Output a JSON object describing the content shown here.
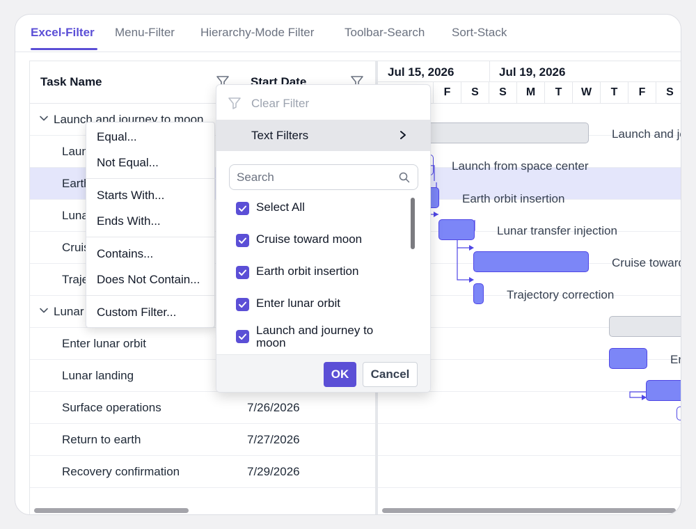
{
  "tabs": [
    {
      "label": "Excel-Filter"
    },
    {
      "label": "Menu-Filter"
    },
    {
      "label": "Hierarchy-Mode Filter"
    },
    {
      "label": "Toolbar-Search"
    },
    {
      "label": "Sort-Stack"
    }
  ],
  "grid": {
    "columns": {
      "task_name": "Task Name",
      "start_date": "Start Date"
    },
    "rows": [
      {
        "task": "Launch and journey to moon",
        "date": "",
        "level": 0,
        "expanded": true,
        "selected": false
      },
      {
        "task": "Launch from space center",
        "date": "",
        "level": 1,
        "selected": false
      },
      {
        "task": "Earth orbit insertion",
        "date": "",
        "level": 1,
        "selected": true
      },
      {
        "task": "Lunar transfer injection",
        "date": "",
        "level": 1,
        "selected": false
      },
      {
        "task": "Cruise toward moon",
        "date": "",
        "level": 1,
        "selected": false
      },
      {
        "task": "Trajectory correction",
        "date": "",
        "level": 1,
        "selected": false
      },
      {
        "task": "Lunar operations",
        "date": "",
        "level": 0,
        "expanded": true,
        "selected": false
      },
      {
        "task": "Enter lunar orbit",
        "date": "",
        "level": 1,
        "selected": false
      },
      {
        "task": "Lunar landing",
        "date": "",
        "level": 1,
        "selected": false
      },
      {
        "task": "Surface operations",
        "date": "7/26/2026",
        "level": 1,
        "selected": false
      },
      {
        "task": "Return to earth",
        "date": "7/27/2026",
        "level": 1,
        "selected": false
      },
      {
        "task": "Recovery confirmation",
        "date": "7/29/2026",
        "level": 1,
        "selected": false
      }
    ]
  },
  "chart": {
    "weeks": [
      "Jul 15, 2026",
      "Jul 19, 2026"
    ],
    "days": [
      "F",
      "S",
      "S",
      "M",
      "T",
      "W",
      "T",
      "F",
      "S"
    ],
    "bar_labels": {
      "launch_journey": "Launch and journey to moon",
      "launch_center": "Launch from space center",
      "earth_orbit": "Earth orbit insertion",
      "lunar_transfer": "Lunar transfer injection",
      "cruise": "Cruise toward moon",
      "trajectory": "Trajectory correction",
      "enter_lunar": "Enter lunar orbit"
    },
    "colors": {
      "task_bar": "#7c86f7",
      "task_border": "#4f46e5",
      "parent_bar": "#e5e7eb",
      "selection": "#e4e6fb"
    }
  },
  "text_filter_menu": {
    "items": [
      "Equal...",
      "Not Equal...",
      "Starts With...",
      "Ends With...",
      "Contains...",
      "Does Not Contain...",
      "Custom Filter..."
    ]
  },
  "filter_popup": {
    "clear_filter": "Clear Filter",
    "text_filters": "Text Filters",
    "search_placeholder": "Search",
    "options": [
      {
        "label": "Select All",
        "checked": true
      },
      {
        "label": "Cruise toward moon",
        "checked": true
      },
      {
        "label": "Earth orbit insertion",
        "checked": true
      },
      {
        "label": "Enter lunar orbit",
        "checked": true
      },
      {
        "label": "Launch and journey to moon",
        "checked": true
      }
    ],
    "ok": "OK",
    "cancel": "Cancel"
  },
  "accent_color": "#5b4fd6"
}
